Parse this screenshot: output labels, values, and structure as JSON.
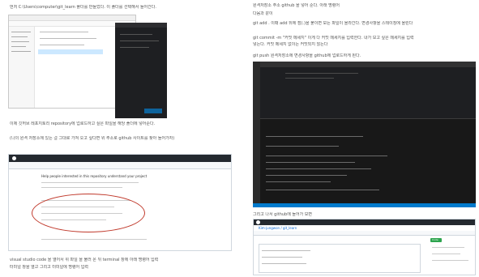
{
  "left": {
    "intro_line": "먼저 C:\\Users\\computer\\git_learn 폴더를 만들었다. 이 폴더를 선택해서 들어간다.",
    "midtext_1": "이제 깃허브 레포지토리 repository에 업로드하고 싶은 파일을 해당 폴더에 넣어준다.",
    "midtext_2": "(나의 원격 저장소에 있는 걸 그대로 가져 오고 싶다면 위 주소로 github 사이트를 찾아 들어가자)",
    "github_banner": "Help people interested in this repository understand your project",
    "bottom_line_1": "visual studio code 을 열어서 위 파일 을 불러 온 뒤 terminal 창에 아래 명령어 입력",
    "bottom_line_2": "터미널 창을 열고 그리고 터미널에 명령어 입력"
  },
  "right": {
    "line_1": "원격저장소 주소 github 을 넣어 준다. 아래 명령어",
    "line_2": "다음과 같이",
    "line_3": "git add . 이때 add 뒤에 점(.)을 붙이면 모든 파일이 올라간다. 변경사항을 스테이징에 올린다",
    "line_4": "git commit -m \"커밋 메세지\" 이게 다 커밋 메세지를 입력한다. 내가 보고 싶은 메세지를 입력",
    "line_5": "넣는다. 커밋 메세지 없이는 커밋되지 않는다",
    "line_6": "git push 원격저장소에 변경사항을 github에 업로드하게 된다.",
    "caption": "그리고 나서 github에 들어가 보면",
    "github_repo_title": "Kim-jungwon / git_learn",
    "code_button": "Code"
  }
}
